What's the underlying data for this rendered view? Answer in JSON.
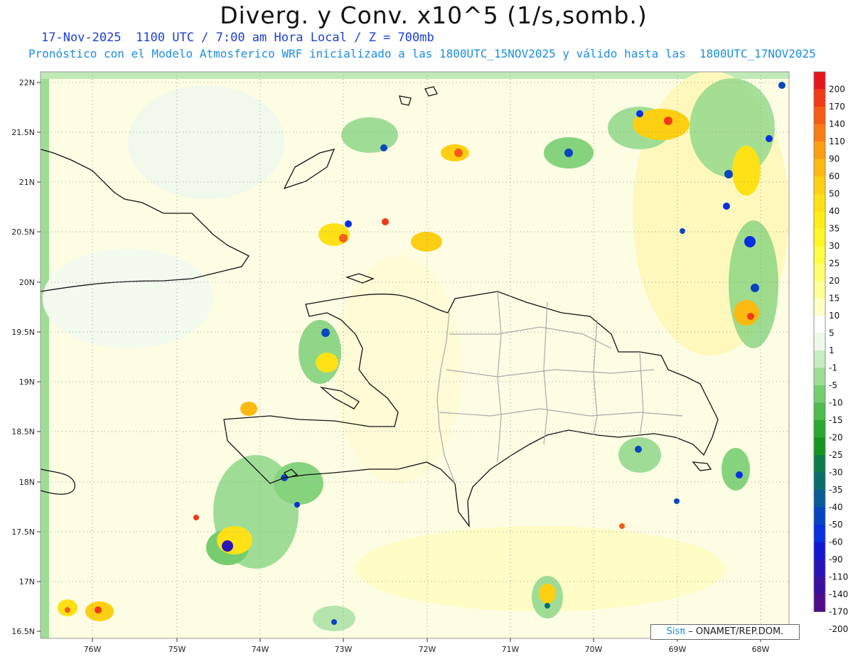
{
  "title": "Diverg. y Conv. x10^5 (1/s,somb.)",
  "subtitle_date": "17-Nov-2025  1100 UTC / 7:00 am Hora Local / Z = 700mb",
  "subtitle_model": "Pronóstico con el Modelo Atmosferico WRF inicializado a las 1800UTC_15NOV2025 y válido hasta las  1800UTC_17NOV2025",
  "lat_labels": [
    "22N",
    "21.5N",
    "21N",
    "20.5N",
    "20N",
    "19.5N",
    "19N",
    "18.5N",
    "18N",
    "17.5N",
    "17N",
    "16.5N"
  ],
  "lon_labels": [
    "76W",
    "75W",
    "74W",
    "73W",
    "72W",
    "71W",
    "70W",
    "69W",
    "68W"
  ],
  "colorbar": {
    "labels": [
      "200",
      "170",
      "140",
      "110",
      "90",
      "60",
      "50",
      "40",
      "35",
      "30",
      "25",
      "20",
      "15",
      "10",
      "5",
      "1",
      "-1",
      "-5",
      "-10",
      "-15",
      "-20",
      "-25",
      "-30",
      "-35",
      "-40",
      "-50",
      "-60",
      "-90",
      "-110",
      "-140",
      "-170",
      "-200"
    ],
    "colors": [
      "#e8141c",
      "#f03a18",
      "#f55c16",
      "#f87d14",
      "#fb9e12",
      "#fcb911",
      "#fdcf12",
      "#fde114",
      "#feed17",
      "#fef625",
      "#fffb45",
      "#fffd6f",
      "#ffff99",
      "#ffffc8",
      "#ffffff",
      "#eef8ea",
      "#c6ecc0",
      "#9fdd96",
      "#76cd70",
      "#4fbc4d",
      "#2aa830",
      "#169520",
      "#0d7e4a",
      "#0a6d6e",
      "#0a5c99",
      "#0845c0",
      "#0630e0",
      "#1218d2",
      "#2a14b8",
      "#3d0fa0",
      "#500c8c"
    ]
  },
  "credit_brand": "Sisπ",
  "credit_text": "– ONAMET/REP.DOM."
}
